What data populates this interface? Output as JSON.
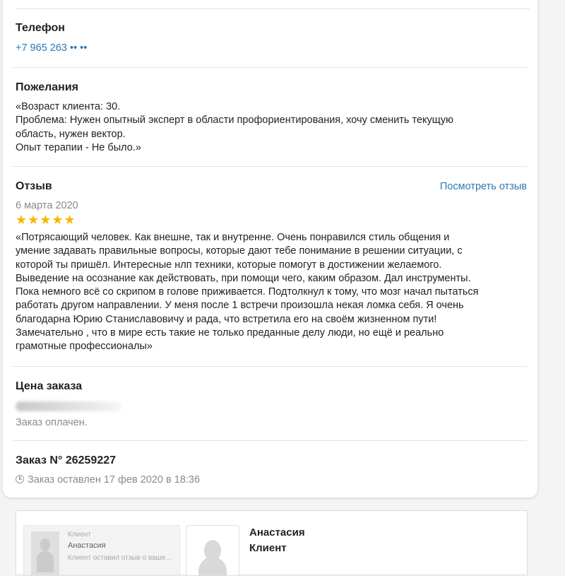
{
  "phone": {
    "title": "Телефон",
    "value": "+7 965 263 •• ••"
  },
  "wishes": {
    "title": "Пожелания",
    "lines": [
      "«Возраст клиента: 30.",
      "Проблема: Нужен опытный эксперт в области профориентирования, хочу сменить текущую",
      "область, нужен вектор.",
      "Опыт терапии - Не было.»"
    ]
  },
  "review": {
    "title": "Отзыв",
    "link": "Посмотреть отзыв",
    "date": "6 марта 2020",
    "rating": 4.5,
    "stars": "★★★★★",
    "lines": [
      "«Потрясающий человек. Как внешне, так и внутренне. Очень понравился стиль общения и",
      "умение задавать правильные вопросы, которые дают тебе понимание в решении ситуации, с",
      "которой ты пришёл. Интересные нлп техники, которые помогут в достижении желаемого.",
      "Выведение на осознание как действовать, при помощи чего, каким образом. Дал инструменты.",
      "Пока немного всё со скрипом в голове приживается. Подтолкнул к тому, что мозг начал пытаться",
      "работать другом направлении. У меня после 1 встречи произошла некая ломка себя. Я очень",
      "благодарна Юрию Станиславовичу и рада, что встретила его на своём жизненном пути!",
      "Замечательно , что в мире есть такие не только преданные делу люди, но ещё и реально",
      "грамотные профессионалы»"
    ]
  },
  "price": {
    "title": "Цена заказа",
    "status": "Заказ оплачен."
  },
  "order": {
    "title": "Заказ N° 26259227",
    "placed": "Заказ оставлен 17 фев 2020 в 18:36"
  },
  "client_panel": {
    "mini_role": "Клиент",
    "mini_name": "Анастасия",
    "mini_text": "Клиент оставил отзыв о ваше...",
    "name": "Анастасия",
    "role": "Клиент"
  },
  "colors": {
    "accent": "#2a7ab5",
    "star": "#f7b500"
  }
}
